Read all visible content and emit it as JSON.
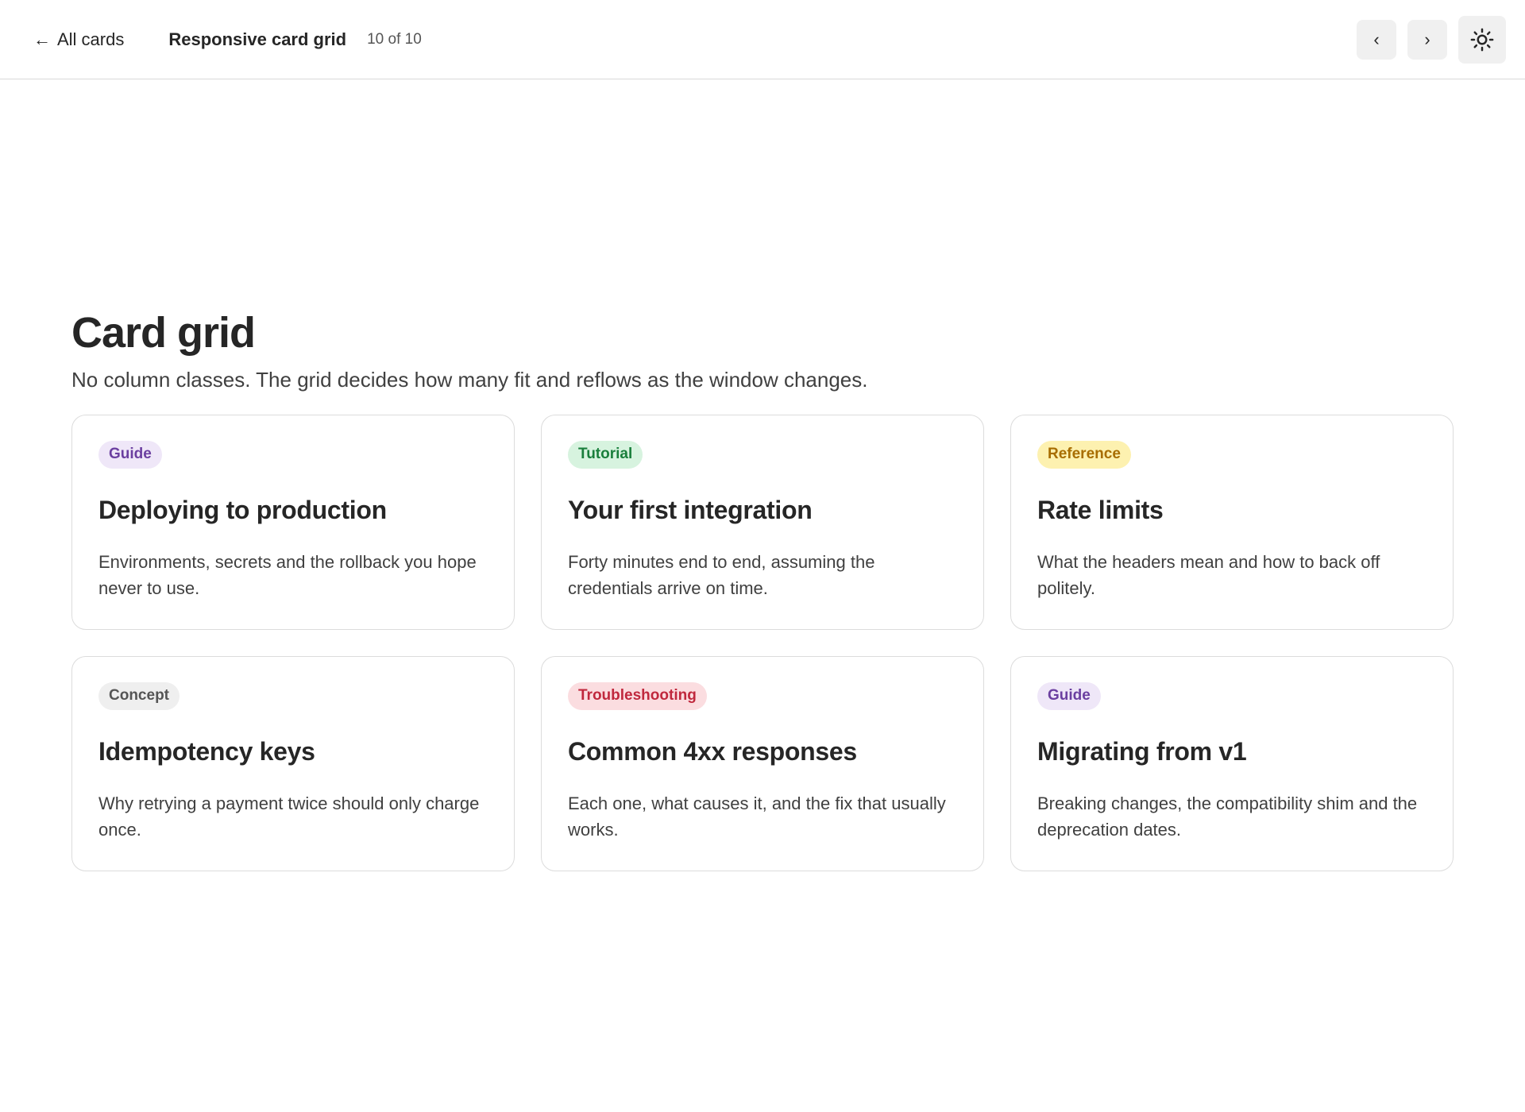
{
  "topbar": {
    "back_label": "All cards",
    "deck_title": "Responsive card grid",
    "counter": "10 of 10",
    "prev_glyph": "‹",
    "next_glyph": "›",
    "theme_icon": "sun-icon"
  },
  "page": {
    "title": "Card grid",
    "subtitle": "No column classes. The grid decides how many fit and reflows as the window changes."
  },
  "cards": [
    {
      "tag": "Guide",
      "tag_color": "#6b3fa0",
      "tag_bg": "#efe7f8",
      "title": "Deploying to production",
      "description": "Environments, secrets and the rollback you hope never to use."
    },
    {
      "tag": "Tutorial",
      "tag_color": "#1a7f3c",
      "tag_bg": "#d7f3df",
      "title": "Your first integration",
      "description": "Forty minutes end to end, assuming the credentials arrive on time."
    },
    {
      "tag": "Reference",
      "tag_color": "#a86d00",
      "tag_bg": "#fdf1b0",
      "title": "Rate limits",
      "description": "What the headers mean and how to back off politely."
    },
    {
      "tag": "Concept",
      "tag_color": "#555555",
      "tag_bg": "#efefef",
      "title": "Idempotency keys",
      "description": "Why retrying a payment twice should only charge once."
    },
    {
      "tag": "Troubleshooting",
      "tag_color": "#c0283d",
      "tag_bg": "#fbdde0",
      "title": "Common 4xx responses",
      "description": "Each one, what causes it, and the fix that usually works."
    },
    {
      "tag": "Guide",
      "tag_color": "#6b3fa0",
      "tag_bg": "#efe7f8",
      "title": "Migrating from v1",
      "description": "Breaking changes, the compatibility shim and the deprecation dates."
    }
  ]
}
